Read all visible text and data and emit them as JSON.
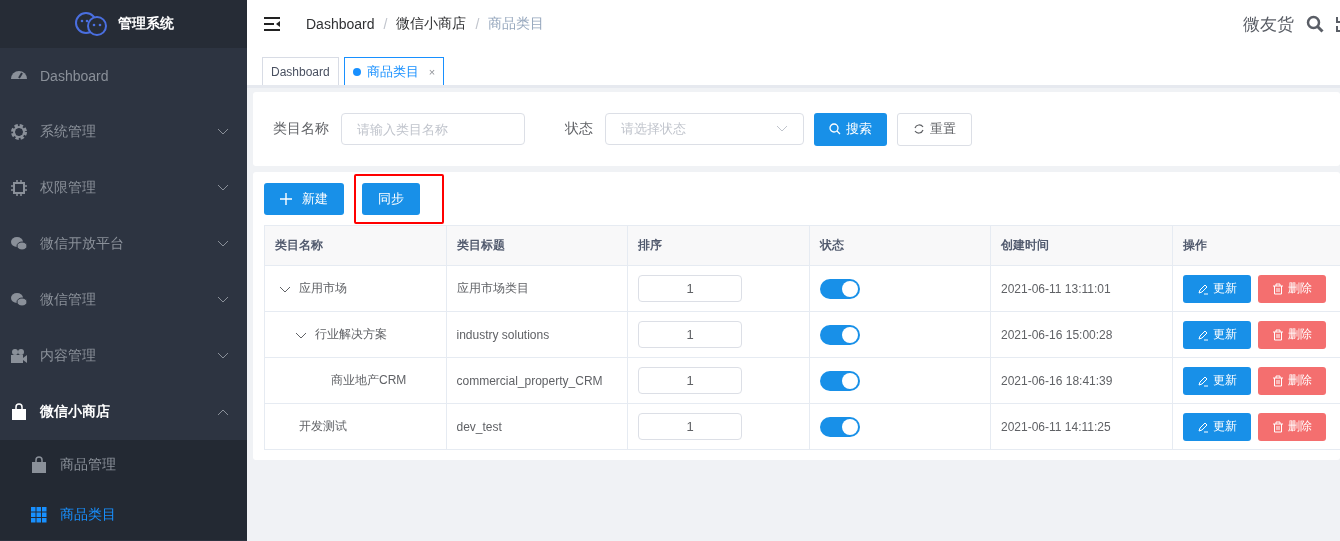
{
  "sidebar": {
    "title": "管理系统",
    "items": [
      {
        "label": "Dashboard",
        "has_children": false,
        "selected": false
      },
      {
        "label": "系统管理",
        "has_children": true,
        "expanded": false,
        "selected": false
      },
      {
        "label": "权限管理",
        "has_children": true,
        "expanded": false,
        "selected": false
      },
      {
        "label": "微信开放平台",
        "has_children": true,
        "expanded": false,
        "selected": false
      },
      {
        "label": "微信管理",
        "has_children": true,
        "expanded": false,
        "selected": false
      },
      {
        "label": "内容管理",
        "has_children": true,
        "expanded": false,
        "selected": false
      },
      {
        "label": "微信小商店",
        "has_children": true,
        "expanded": true,
        "selected": true,
        "children": [
          {
            "label": "商品管理",
            "selected": false
          },
          {
            "label": "商品类目",
            "selected": true
          }
        ]
      }
    ]
  },
  "header": {
    "breadcrumb": [
      "Dashboard",
      "微信小商店",
      "商品类目"
    ],
    "separator": "/",
    "user": "微友货"
  },
  "tabs": [
    {
      "label": "Dashboard",
      "selected": false
    },
    {
      "label": "商品类目",
      "selected": true,
      "close": "×"
    }
  ],
  "search": {
    "fields": [
      {
        "kind": "input",
        "label": "类目名称",
        "placeholder": "请输入类目名称"
      },
      {
        "kind": "select",
        "label": "状态",
        "placeholder": "请选择状态"
      }
    ],
    "buttons": [
      {
        "kind": "primary",
        "label": "搜索"
      },
      {
        "kind": "default",
        "label": "重置"
      }
    ]
  },
  "toolbar": [
    {
      "label": "新建",
      "kind": "add",
      "highlighted": false
    },
    {
      "label": "同步",
      "kind": "plain",
      "highlighted": true
    }
  ],
  "table": {
    "columns": [
      "类目名称",
      "类目标题",
      "排序",
      "状态",
      "创建时间",
      "操作"
    ],
    "rows": [
      {
        "name": "应用市场",
        "title": "应用市场类目",
        "sort": "1",
        "on": true,
        "created": "2021-06-11 13:11:01",
        "actions": [
          "更新",
          "删除"
        ],
        "expanded": true,
        "children": [
          {
            "name": "行业解决方案",
            "title": "industry solutions",
            "sort": "1",
            "on": true,
            "created": "2021-06-16 15:00:28",
            "actions": [
              "更新",
              "删除"
            ],
            "expanded": true,
            "children": [
              {
                "name": "商业地产CRM",
                "title": "commercial_property_CRM",
                "sort": "1",
                "on": true,
                "created": "2021-06-16 18:41:39",
                "actions": [
                  "更新",
                  "删除"
                ]
              }
            ]
          }
        ]
      },
      {
        "name": "开发测试",
        "title": "dev_test",
        "sort": "1",
        "on": true,
        "created": "2021-06-11 14:11:25",
        "actions": [
          "更新",
          "删除"
        ]
      }
    ]
  }
}
